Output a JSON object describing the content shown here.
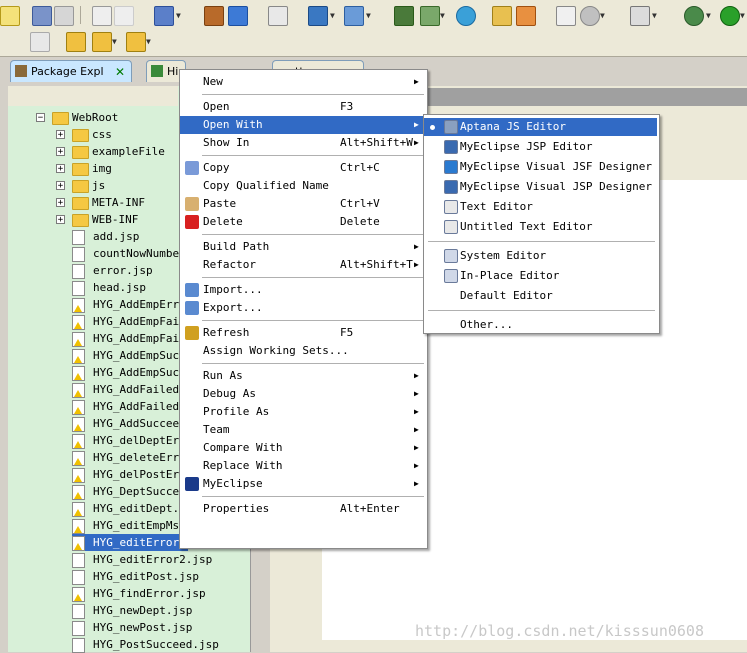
{
  "tabs": {
    "package_explorer": "Package Expl",
    "hierarchy": "Hi",
    "editor_tab": "tt"
  },
  "tree": {
    "root": "WebRoot",
    "folders": [
      "css",
      "exampleFile",
      "img",
      "js",
      "META-INF",
      "WEB-INF"
    ],
    "files": [
      {
        "name": "add.jsp",
        "warn": false
      },
      {
        "name": "countNowNumber.",
        "warn": false
      },
      {
        "name": "error.jsp",
        "warn": false
      },
      {
        "name": "head.jsp",
        "warn": false
      },
      {
        "name": "HYG_AddEmpError",
        "warn": true
      },
      {
        "name": "HYG_AddEmpFaile",
        "warn": true
      },
      {
        "name": "HYG_AddEmpFaile",
        "warn": true
      },
      {
        "name": "HYG_AddEmpSucce",
        "warn": true
      },
      {
        "name": "HYG_AddEmpSucce",
        "warn": true
      },
      {
        "name": "HYG_AddFailed.",
        "warn": true
      },
      {
        "name": "HYG_AddFailed2.",
        "warn": true
      },
      {
        "name": "HYG_AddSucceed.",
        "warn": true
      },
      {
        "name": "HYG_delDeptErro",
        "warn": true
      },
      {
        "name": "HYG_deleteError",
        "warn": true
      },
      {
        "name": "HYG_delPostErro",
        "warn": true
      },
      {
        "name": "HYG_DeptSucceed",
        "warn": true
      },
      {
        "name": "HYG_editDept.js",
        "warn": true
      },
      {
        "name": "HYG_editEmpMsg.",
        "warn": true
      },
      {
        "name": "HYG_editError.",
        "warn": true,
        "selected": true
      },
      {
        "name": "HYG_editError2.jsp",
        "warn": false
      },
      {
        "name": "HYG_editPost.jsp",
        "warn": false
      },
      {
        "name": "HYG_findError.jsp",
        "warn": true
      },
      {
        "name": "HYG_newDept.jsp",
        "warn": false
      },
      {
        "name": "HYG_newPost.jsp",
        "warn": false
      },
      {
        "name": "HYG_PostSucceed.jsp",
        "warn": false
      }
    ]
  },
  "context_menu": {
    "items": [
      {
        "label": "New",
        "shortcut": "",
        "arrow": true,
        "icon": ""
      },
      {
        "sep": true
      },
      {
        "label": "Open",
        "shortcut": "F3",
        "arrow": false,
        "icon": ""
      },
      {
        "label": "Open With",
        "shortcut": "",
        "arrow": true,
        "icon": "",
        "highlighted": true
      },
      {
        "label": "Show In",
        "shortcut": "Alt+Shift+W",
        "arrow": true,
        "icon": ""
      },
      {
        "sep": true
      },
      {
        "label": "Copy",
        "shortcut": "Ctrl+C",
        "arrow": false,
        "icon": "copy-icon"
      },
      {
        "label": "Copy Qualified Name",
        "shortcut": "",
        "arrow": false,
        "icon": ""
      },
      {
        "label": "Paste",
        "shortcut": "Ctrl+V",
        "arrow": false,
        "icon": "paste-icon"
      },
      {
        "label": "Delete",
        "shortcut": "Delete",
        "arrow": false,
        "icon": "delete-icon"
      },
      {
        "sep": true
      },
      {
        "label": "Build Path",
        "shortcut": "",
        "arrow": true,
        "icon": ""
      },
      {
        "label": "Refactor",
        "shortcut": "Alt+Shift+T",
        "arrow": true,
        "icon": ""
      },
      {
        "sep": true
      },
      {
        "label": "Import...",
        "shortcut": "",
        "arrow": false,
        "icon": "import-icon"
      },
      {
        "label": "Export...",
        "shortcut": "",
        "arrow": false,
        "icon": "export-icon"
      },
      {
        "sep": true
      },
      {
        "label": "Refresh",
        "shortcut": "F5",
        "arrow": false,
        "icon": "refresh-icon"
      },
      {
        "label": "Assign Working Sets...",
        "shortcut": "",
        "arrow": false,
        "icon": ""
      },
      {
        "sep": true
      },
      {
        "label": "Run As",
        "shortcut": "",
        "arrow": true,
        "icon": ""
      },
      {
        "label": "Debug As",
        "shortcut": "",
        "arrow": true,
        "icon": ""
      },
      {
        "label": "Profile As",
        "shortcut": "",
        "arrow": true,
        "icon": ""
      },
      {
        "label": "Team",
        "shortcut": "",
        "arrow": true,
        "icon": ""
      },
      {
        "label": "Compare With",
        "shortcut": "",
        "arrow": true,
        "icon": ""
      },
      {
        "label": "Replace With",
        "shortcut": "",
        "arrow": true,
        "icon": ""
      },
      {
        "label": "MyEclipse",
        "shortcut": "",
        "arrow": true,
        "icon": "myeclipse-icon"
      },
      {
        "sep": true
      },
      {
        "label": "Properties",
        "shortcut": "Alt+Enter",
        "arrow": false,
        "icon": ""
      }
    ]
  },
  "submenu": {
    "items": [
      {
        "label": "Aptana JS Editor",
        "icon": "aptana-icon",
        "highlighted": true,
        "bullet": true
      },
      {
        "label": "MyEclipse JSP Editor",
        "icon": "jsp-editor-icon"
      },
      {
        "label": "MyEclipse Visual JSF Designer",
        "icon": "jsf-designer-icon"
      },
      {
        "label": "MyEclipse Visual JSP Designer",
        "icon": "jsp-designer-icon"
      },
      {
        "label": "Text Editor",
        "icon": "text-editor-icon"
      },
      {
        "label": "Untitled Text Editor",
        "icon": "text-editor-icon"
      },
      {
        "sep": true
      },
      {
        "label": "System Editor",
        "icon": "system-editor-icon"
      },
      {
        "label": "In-Place Editor",
        "icon": "inplace-editor-icon"
      },
      {
        "label": "Default Editor",
        "icon": ""
      },
      {
        "sep": true
      },
      {
        "label": "Other...",
        "icon": ""
      }
    ]
  },
  "watermark": "http://blog.csdn.net/kisssun0608",
  "colors": {
    "highlight": "#316ac5",
    "explorer_bg": "#d8f0d8",
    "chrome": "#ece9d8"
  }
}
